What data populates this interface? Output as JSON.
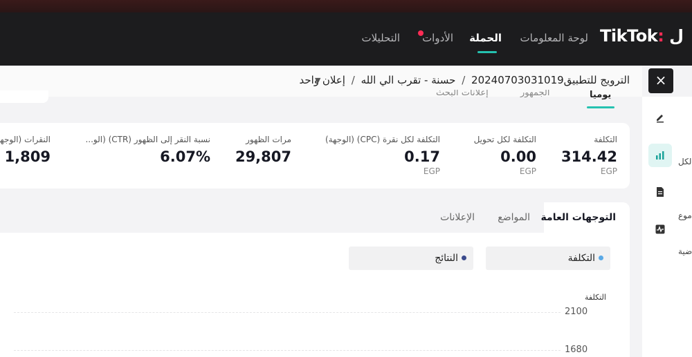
{
  "brand": {
    "logo": "TikTok"
  },
  "nav": [
    {
      "label": "لوحة المعلومات",
      "active": false
    },
    {
      "label": "الحملة",
      "active": true
    },
    {
      "label": "الأدوات",
      "active": false,
      "badge": true
    },
    {
      "label": "التحليلات",
      "active": false
    }
  ],
  "breadcrumb": {
    "campaign": "الترويج للتطبيق20240703031019",
    "adgroup": "حسنة - تقرب الي الله",
    "ad": "إعلان واحد",
    "separator": "/"
  },
  "close_label": "×",
  "subtabs": [
    {
      "label": "يوميا",
      "active": true
    },
    {
      "label": "الجمهور",
      "active": false
    },
    {
      "label": "إعلانات البحث",
      "active": false
    }
  ],
  "metrics": [
    {
      "label": "التكلفة",
      "value": "314.42",
      "unit": "EGP"
    },
    {
      "label": "التكلفة لكل تحويل",
      "value": "0.00",
      "unit": "EGP"
    },
    {
      "label": "التكلفة لكل نقرة (CPC) (الوجهة)",
      "value": "0.17",
      "unit": "EGP"
    },
    {
      "label": "مرات الظهور",
      "value": "29,807",
      "unit": ""
    },
    {
      "label": "نسبة النقر إلى الظهور (CTR) (الو...",
      "value": "6.07%",
      "unit": ""
    },
    {
      "label": "النقرات (الوجهة",
      "value": "1,809",
      "unit": ""
    }
  ],
  "chart_tabs": [
    {
      "label": "التوجهات العامة",
      "active": true
    },
    {
      "label": "المواضع",
      "active": false
    },
    {
      "label": "الإعلانات",
      "active": false
    }
  ],
  "legend": [
    {
      "label": "التكلفة",
      "color": "#5aa9e6"
    },
    {
      "label": "النتائج",
      "color": "#3b4a8c"
    }
  ],
  "chart_data": {
    "type": "line",
    "ylabel": "التكلفة",
    "y_ticks": [
      "2100",
      "1680"
    ],
    "series": [
      {
        "name": "التكلفة",
        "values": []
      },
      {
        "name": "النتائج",
        "values": []
      }
    ]
  },
  "rail": {
    "icons": [
      "edit-icon",
      "chart-icon",
      "document-icon",
      "activity-icon"
    ],
    "texts": [
      "الكل",
      "موع",
      "ضية"
    ]
  }
}
